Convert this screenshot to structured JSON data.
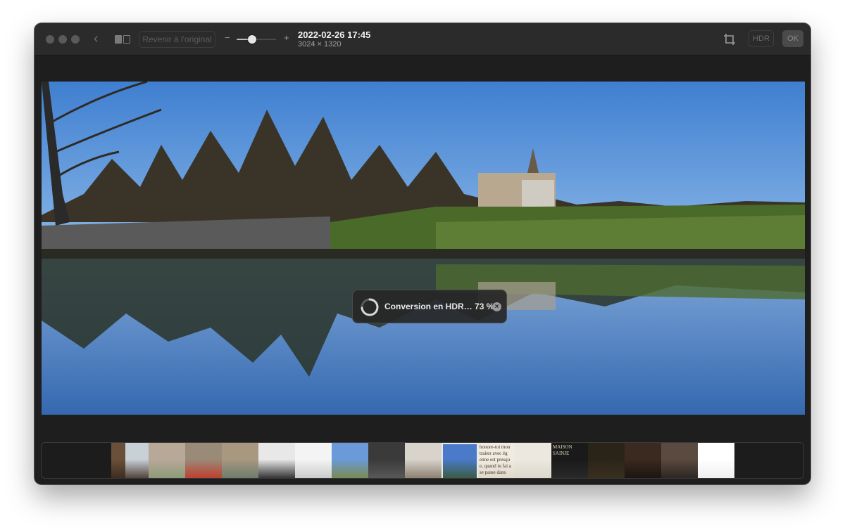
{
  "window": {
    "title": "2022-02-26 17:45",
    "dimensions": "3024 × 1320"
  },
  "toolbar": {
    "back_icon": "chevron-left-icon",
    "split_view_icon": "split-view-icon",
    "revert_label": "Revenir à l'original",
    "zoom_minus": "−",
    "zoom_plus": "+",
    "zoom_level": 0.4,
    "crop_icon": "crop-icon",
    "hdr_label": "HDR",
    "ok_label": "OK"
  },
  "progress_hud": {
    "text": "Conversion en HDR… 73 %",
    "progress": 0.73,
    "close_icon": "close-circle-icon"
  },
  "filmstrip": {
    "thumbnails": [
      {
        "w": 20,
        "colors": [
          "#6a5038",
          "#3a2a20"
        ],
        "text": ""
      },
      {
        "w": 33,
        "colors": [
          "#c8d0d8",
          "#4a3a30"
        ],
        "text": ""
      },
      {
        "w": 52,
        "colors": [
          "#b8a898",
          "#8a9a78"
        ],
        "text": ""
      },
      {
        "w": 52,
        "colors": [
          "#9a8a78",
          "#c03a2a"
        ],
        "text": ""
      },
      {
        "w": 52,
        "colors": [
          "#a89880",
          "#6a7a6a"
        ],
        "text": ""
      },
      {
        "w": 52,
        "colors": [
          "#e8e8e8",
          "#2a2a2a"
        ],
        "text": ""
      },
      {
        "w": 52,
        "colors": [
          "#f4f4f4",
          "#c8c8c8"
        ],
        "text": ""
      },
      {
        "w": 52,
        "colors": [
          "#6a9ad8",
          "#7a8a4a"
        ],
        "text": ""
      },
      {
        "w": 52,
        "colors": [
          "#3a3a3a",
          "#5a5a5a"
        ],
        "text": ""
      },
      {
        "w": 52,
        "colors": [
          "#d8d4cc",
          "#8a7a6a"
        ],
        "text": ""
      },
      {
        "w": 52,
        "colors": [
          "#4a7ac8",
          "#3a5a3a"
        ],
        "text": "",
        "selected": true
      },
      {
        "w": 52,
        "colors": [
          "#f0ebe0",
          "#e0d8c8"
        ],
        "text": "honore-toi mon traiter avec ég enne est presqu e, quand tu fai a se passe dans"
      },
      {
        "w": 52,
        "colors": [
          "#ece8e0",
          "#dcd6ca"
        ],
        "text": ""
      },
      {
        "w": 52,
        "colors": [
          "#1a1a1a",
          "#2a2a2a"
        ],
        "text": "MAISON SAINJE"
      },
      {
        "w": 52,
        "colors": [
          "#2a2418",
          "#3a3020"
        ],
        "text": ""
      },
      {
        "w": 52,
        "colors": [
          "#3a2a20",
          "#1a1410"
        ],
        "text": ""
      },
      {
        "w": 52,
        "colors": [
          "#5a4a40",
          "#2a2420"
        ],
        "text": ""
      },
      {
        "w": 52,
        "colors": [
          "#ffffff",
          "#eeeeee"
        ],
        "text": ""
      }
    ]
  }
}
